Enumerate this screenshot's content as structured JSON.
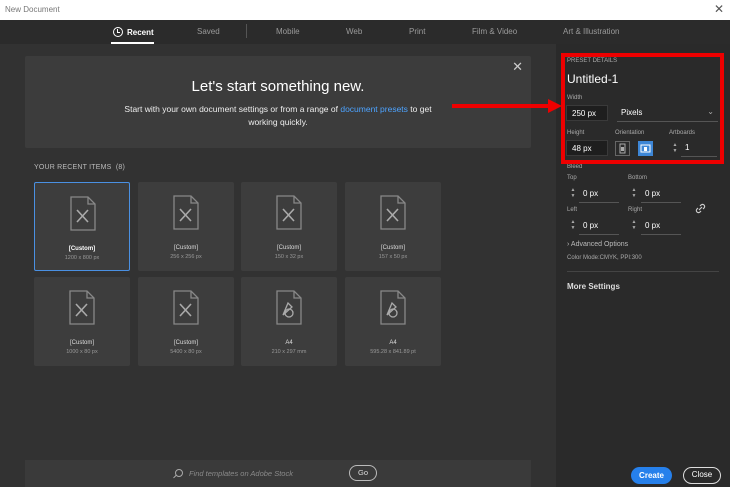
{
  "window": {
    "title": "New Document",
    "close_glyph": "✕"
  },
  "tabs": [
    {
      "label": "Recent",
      "active": true
    },
    {
      "label": "Saved"
    },
    {
      "label": "Mobile"
    },
    {
      "label": "Web"
    },
    {
      "label": "Print"
    },
    {
      "label": "Film & Video"
    },
    {
      "label": "Art & Illustration"
    }
  ],
  "hero": {
    "title": "Let's start something new.",
    "text_before": "Start with your own document settings or from a range of ",
    "link": "document presets",
    "text_after": " to get working quickly.",
    "close_glyph": "✕"
  },
  "recent": {
    "label": "YOUR RECENT ITEMS",
    "count": "(8)",
    "items": [
      {
        "name": "[Custom]",
        "dims": "1200 x 800 px",
        "icon": "document-icon",
        "selected": true
      },
      {
        "name": "[Custom]",
        "dims": "256 x 256 px",
        "icon": "document-icon"
      },
      {
        "name": "[Custom]",
        "dims": "150 x 32 px",
        "icon": "document-icon"
      },
      {
        "name": "[Custom]",
        "dims": "157 x 50 px",
        "icon": "document-icon"
      },
      {
        "name": "[Custom]",
        "dims": "1000 x 80 px",
        "icon": "document-icon"
      },
      {
        "name": "[Custom]",
        "dims": "5400 x 80 px",
        "icon": "document-icon"
      },
      {
        "name": "A4",
        "dims": "210 x 297 mm",
        "icon": "print-document-icon"
      },
      {
        "name": "A4",
        "dims": "595.28 x 841.89 pt",
        "icon": "print-document-icon"
      }
    ]
  },
  "search": {
    "placeholder": "Find templates on Adobe Stock",
    "go_label": "Go"
  },
  "preset": {
    "section_label": "PRESET DETAILS",
    "name": "Untitled-1",
    "width_label": "Width",
    "width_value": "250 px",
    "units_value": "Pixels",
    "height_label": "Height",
    "height_value": "48 px",
    "orientation_label": "Orientation",
    "orientation_selected": "landscape",
    "artboards_label": "Artboards",
    "artboards_value": "1",
    "bleed_label": "Bleed",
    "top_label": "Top",
    "top_value": "0 px",
    "bottom_label": "Bottom",
    "bottom_value": "0 px",
    "left_label": "Left",
    "left_value": "0 px",
    "right_label": "Right",
    "right_value": "0 px",
    "advanced_label": "Advanced Options",
    "color_mode": "Color Mode:CMYK, PPI:300",
    "more_settings": "More Settings"
  },
  "buttons": {
    "create": "Create",
    "close": "Close"
  },
  "colors": {
    "highlight": "#e00000",
    "accent": "#2680eb",
    "panel": "#2a2a2a",
    "main": "#323232"
  }
}
